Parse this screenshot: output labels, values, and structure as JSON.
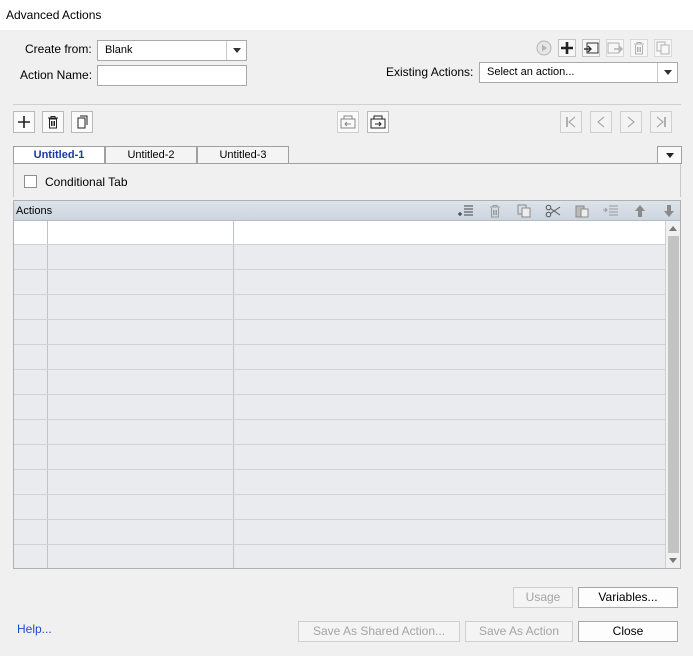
{
  "window": {
    "title": "Advanced Actions"
  },
  "form": {
    "create_from_label": "Create from:",
    "create_from_value": "Blank",
    "action_name_label": "Action Name:",
    "action_name_value": "",
    "existing_actions_label": "Existing Actions:",
    "existing_actions_value": "Select an action..."
  },
  "top_right_icons": [
    "preview-icon",
    "add-icon",
    "import-icon",
    "export-icon",
    "delete-icon",
    "duplicate-icon"
  ],
  "toolbar_icons": {
    "left": [
      "add-icon",
      "delete-icon",
      "duplicate-icon"
    ],
    "center": [
      "import-icon",
      "export-icon"
    ],
    "right": [
      "first-icon",
      "previous-icon",
      "next-icon",
      "last-icon"
    ]
  },
  "tabs": [
    {
      "label": "Untitled-1",
      "active": true
    },
    {
      "label": "Untitled-2",
      "active": false
    },
    {
      "label": "Untitled-3",
      "active": false
    }
  ],
  "conditional": {
    "label": "Conditional Tab",
    "checked": false
  },
  "actions_grid": {
    "title": "Actions",
    "header_icons": [
      "insert-icon",
      "delete-icon",
      "copy-icon",
      "cut-icon",
      "paste-icon",
      "insert-row-icon",
      "move-up-icon",
      "move-down-icon"
    ],
    "row_count": 14
  },
  "buttons": {
    "usage": "Usage",
    "variables": "Variables...",
    "save_as_shared": "Save As Shared Action...",
    "save_as_action": "Save As Action",
    "close": "Close",
    "help": "Help..."
  },
  "colors": {
    "active_tab_text": "#1a37a8",
    "link": "#1a4fc7",
    "grid_header": "#ccd4de"
  }
}
